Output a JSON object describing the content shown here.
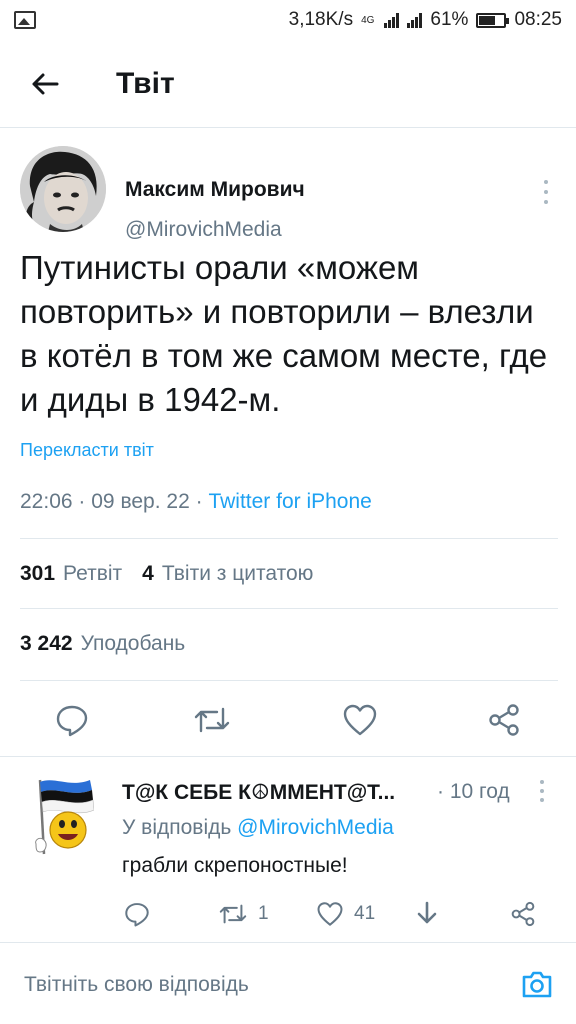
{
  "status_bar": {
    "speed": "3,18K/s",
    "network": "4G",
    "battery": "61%",
    "battery_level": 0.61,
    "time": "08:25"
  },
  "header": {
    "title": "Твіт"
  },
  "tweet": {
    "author_name": "Максим Мирович",
    "author_handle": "@MirovichMedia",
    "text": "Путинисты орали «можем повторить» и повторили – влезли в котёл в том же самом месте, где и диды в 1942-м.",
    "translate_label": "Перекласти твіт",
    "time": "22:06",
    "date": "09 вер. 22",
    "separator": "·",
    "client": "Twitter for iPhone",
    "retweets_count": "301",
    "retweets_label": "Ретвіт",
    "quotes_count": "4",
    "quotes_label": "Твіти з цитатою",
    "likes_count": "3 242",
    "likes_label": "Уподобань"
  },
  "reply": {
    "author_name": "Т@К СЕБЕ К☮ММЕНТ@Т...",
    "time": "· 10 год",
    "reply_prefix": "У відповідь",
    "mention": "@MirovichMedia",
    "text": "грабли скрепоностные!",
    "retweets": "1",
    "likes": "41"
  },
  "compose": {
    "placeholder": "Твітніть свою відповідь"
  },
  "colors": {
    "accent": "#1da1f2",
    "secondary_text": "#657786",
    "primary_text": "#14171a",
    "divider": "#e1e8ed"
  },
  "icons": [
    "image-icon",
    "back-arrow-icon",
    "more-icon",
    "reply-icon",
    "retweet-icon",
    "like-icon",
    "share-icon",
    "download-icon",
    "camera-icon"
  ]
}
